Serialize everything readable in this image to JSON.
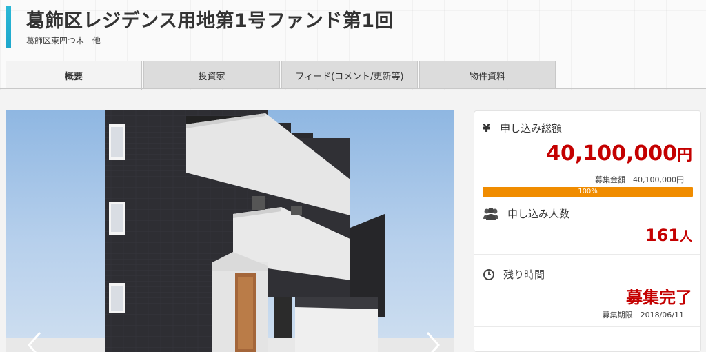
{
  "header": {
    "title": "葛飾区レジデンス用地第1号ファンド第1回",
    "location": "葛飾区東四つ木　他"
  },
  "tabs": [
    {
      "label": "概要",
      "active": true
    },
    {
      "label": "投資家",
      "active": false
    },
    {
      "label": "フィード(コメント/更新等)",
      "active": false
    },
    {
      "label": "物件資料",
      "active": false
    }
  ],
  "carousel": {
    "prev_icon": "chevron-left-icon",
    "next_icon": "chevron-right-icon"
  },
  "panel": {
    "total": {
      "icon": "yen-icon",
      "icon_glyph": "¥",
      "label": "申し込み総額",
      "amount": "40,100,000",
      "unit": "円",
      "target_label": "募集金額",
      "target_amount": "40,100,000円",
      "progress_text": "100%",
      "progress_fraction": 1.0
    },
    "applicants": {
      "icon": "users-icon",
      "label": "申し込み人数",
      "count": "161",
      "unit": "人"
    },
    "time": {
      "icon": "clock-icon",
      "label": "残り時間",
      "status": "募集完了",
      "deadline_label": "募集期限",
      "deadline": "2018/06/11"
    }
  },
  "colors": {
    "accent": "#1ea7cc",
    "highlight_red": "#c40000",
    "progress": "#f08c00"
  }
}
